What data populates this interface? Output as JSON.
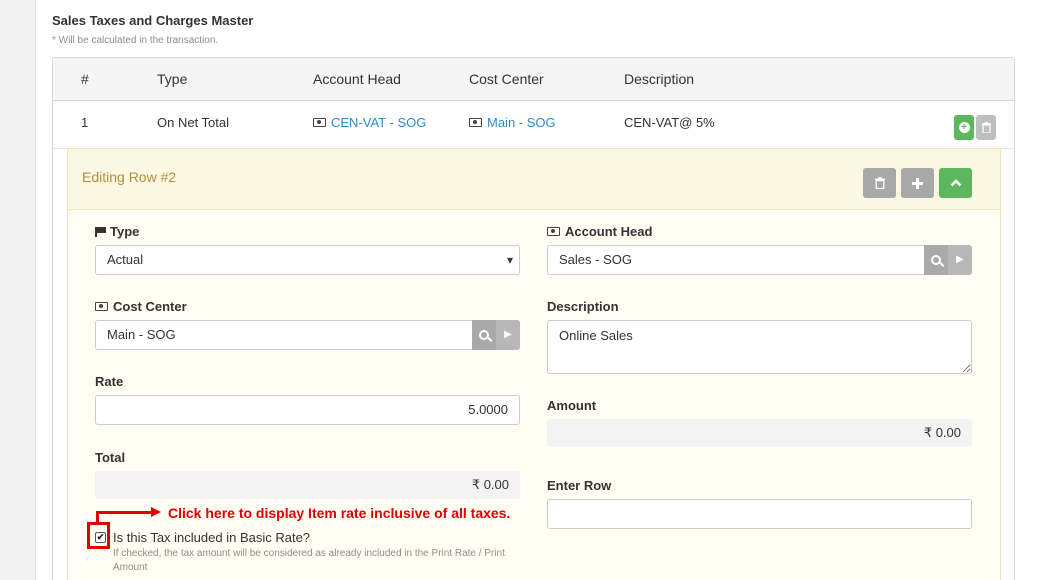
{
  "section": {
    "title": "Sales Taxes and Charges Master",
    "note": "* Will be calculated in the transaction."
  },
  "grid": {
    "columns": [
      "#",
      "Type",
      "Account Head",
      "Cost Center",
      "Description"
    ],
    "rows": [
      {
        "no": "1",
        "type": "On Net Total",
        "account_head": "CEN-VAT - SOG",
        "cost_center": "Main - SOG",
        "description": "CEN-VAT@ 5%"
      }
    ]
  },
  "editing": {
    "title": "Editing Row #2",
    "type_label": "Type",
    "type_value": "Actual",
    "account_head_label": "Account Head",
    "account_head_value": "Sales - SOG",
    "cost_center_label": "Cost Center",
    "cost_center_value": "Main - SOG",
    "description_label": "Description",
    "description_value": "Online Sales",
    "rate_label": "Rate",
    "rate_value": "5.0000",
    "amount_label": "Amount",
    "amount_value": "₹ 0.00",
    "total_label": "Total",
    "total_value": "₹ 0.00",
    "enter_row_label": "Enter Row",
    "enter_row_value": "",
    "checkbox_label": "Is this Tax included in Basic Rate?",
    "checkbox_checked": true,
    "checkbox_help": "If checked, the tax amount will be considered as already included in the Print Rate / Print Amount"
  },
  "annotation": {
    "text": "Click here to display Item rate inclusive of all taxes.",
    "color": "#e00000"
  },
  "icons": [
    "money-icon",
    "flag-icon",
    "search-icon",
    "arrow-right-icon",
    "trash-icon",
    "plus-icon",
    "chevron-up-icon",
    "plus-circle-icon"
  ]
}
